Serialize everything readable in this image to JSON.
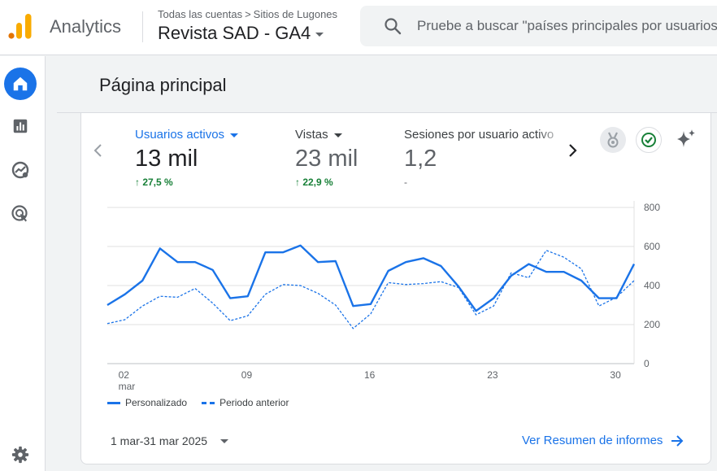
{
  "header": {
    "app_name": "Analytics",
    "breadcrumb": {
      "account": "Todas las cuentas",
      "separator": ">",
      "property_group": "Sitios de Lugones"
    },
    "property": "Revista SAD - GA4",
    "search_placeholder": "Pruebe a buscar \"países principales por usuarios\""
  },
  "nav": {
    "items": [
      {
        "name": "home-icon",
        "active": true
      },
      {
        "name": "reports-icon",
        "active": false
      },
      {
        "name": "explore-icon",
        "active": false
      },
      {
        "name": "advertising-icon",
        "active": false
      }
    ],
    "settings": "gear-icon"
  },
  "page": {
    "title": "Página principal"
  },
  "metrics": [
    {
      "label": "Usuarios activos",
      "value": "13 mil",
      "change": "↑ 27,5 %",
      "active": true
    },
    {
      "label": "Vistas",
      "value": "23 mil",
      "change": "↑ 22,9 %",
      "active": false
    },
    {
      "label": "Sesiones por usuario activo",
      "value": "1,2",
      "change": "-",
      "active": false
    }
  ],
  "colors": {
    "primary": "#1a73e8",
    "positive": "#188038",
    "grid": "#e0e0e0"
  },
  "chart_data": {
    "type": "line",
    "x": [
      1,
      2,
      3,
      4,
      5,
      6,
      7,
      8,
      9,
      10,
      11,
      12,
      13,
      14,
      15,
      16,
      17,
      18,
      19,
      20,
      21,
      22,
      23,
      24,
      25,
      26,
      27,
      28,
      29,
      30,
      31
    ],
    "x_ticks": [
      {
        "day": 2,
        "label": "02",
        "sub": "mar"
      },
      {
        "day": 9,
        "label": "09",
        "sub": ""
      },
      {
        "day": 16,
        "label": "16",
        "sub": ""
      },
      {
        "day": 23,
        "label": "23",
        "sub": ""
      },
      {
        "day": 30,
        "label": "30",
        "sub": ""
      }
    ],
    "y_ticks": [
      0,
      200,
      400,
      600,
      800
    ],
    "ylim": [
      0,
      800
    ],
    "series": [
      {
        "name": "Personalizado",
        "style": "solid",
        "values": [
          300,
          355,
          425,
          590,
          520,
          520,
          480,
          335,
          345,
          570,
          570,
          605,
          520,
          525,
          295,
          305,
          475,
          520,
          540,
          500,
          395,
          270,
          335,
          450,
          510,
          470,
          470,
          425,
          335,
          335,
          510
        ]
      },
      {
        "name": "Periodo anterior",
        "style": "dashed",
        "values": [
          205,
          225,
          295,
          345,
          340,
          385,
          310,
          220,
          245,
          355,
          405,
          400,
          360,
          300,
          180,
          255,
          415,
          405,
          410,
          420,
          390,
          250,
          295,
          465,
          440,
          580,
          545,
          485,
          295,
          340,
          425
        ]
      }
    ],
    "legend_position": "bottom-left",
    "grid": true
  },
  "footer": {
    "date_range": "1 mar-31 mar 2025",
    "report_link": "Ver Resumen de informes"
  }
}
